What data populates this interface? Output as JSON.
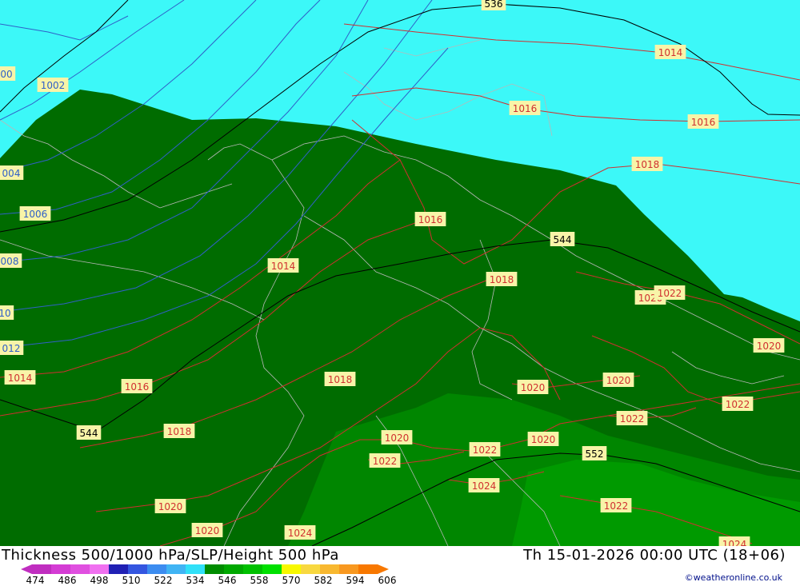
{
  "title": "Thickness 500/1000 hPa/SLP/Height 500 hPa",
  "datetime": "Th 15-01-2026 00:00 UTC (18+06)",
  "credit": "©weatheronline.co.uk",
  "legend": {
    "ticks": [
      "474",
      "486",
      "498",
      "510",
      "522",
      "534",
      "546",
      "558",
      "570",
      "582",
      "594",
      "606"
    ],
    "colors": [
      "#c02ec0",
      "#d43cd4",
      "#e050e0",
      "#f070f0",
      "#2020b4",
      "#3456e0",
      "#3c8cf0",
      "#40b4f4",
      "#30e0f8",
      "#008c00",
      "#00a800",
      "#00c000",
      "#00e000",
      "#f8f800",
      "#f8d840",
      "#f8b830",
      "#f89820",
      "#f87800"
    ]
  },
  "map": {
    "colors": {
      "cyan": "#3cf8f8",
      "dark_green": "#006c00",
      "mid_green": "#008600",
      "light_green": "#009a00",
      "slp_red": "#d03030",
      "slp_blue": "#3060c8",
      "height": "#000000",
      "border": "#b8b8b8",
      "label_bg": "#f8f4a8"
    },
    "labels": [
      {
        "text": "536",
        "kind": "height"
      },
      {
        "text": "544",
        "kind": "height"
      },
      {
        "text": "544",
        "kind": "height"
      },
      {
        "text": "552",
        "kind": "height"
      },
      {
        "text": "1014",
        "kind": "red"
      },
      {
        "text": "1016",
        "kind": "red"
      },
      {
        "text": "1016",
        "kind": "red"
      },
      {
        "text": "1018",
        "kind": "red"
      },
      {
        "text": "1016",
        "kind": "red"
      },
      {
        "text": "1014",
        "kind": "red"
      },
      {
        "text": "1018",
        "kind": "red"
      },
      {
        "text": "1020",
        "kind": "red"
      },
      {
        "text": "1022",
        "kind": "red"
      },
      {
        "text": "1020",
        "kind": "red"
      },
      {
        "text": "1014",
        "kind": "red"
      },
      {
        "text": "1016",
        "kind": "red"
      },
      {
        "text": "1018",
        "kind": "red"
      },
      {
        "text": "1020",
        "kind": "red"
      },
      {
        "text": "1020",
        "kind": "red"
      },
      {
        "text": "1022",
        "kind": "red"
      },
      {
        "text": "1022",
        "kind": "red"
      },
      {
        "text": "1018",
        "kind": "red"
      },
      {
        "text": "1020",
        "kind": "red"
      },
      {
        "text": "1022",
        "kind": "red"
      },
      {
        "text": "1022",
        "kind": "red"
      },
      {
        "text": "1020",
        "kind": "red"
      },
      {
        "text": "1020",
        "kind": "red"
      },
      {
        "text": "1024",
        "kind": "red"
      },
      {
        "text": "1020",
        "kind": "red"
      },
      {
        "text": "1024",
        "kind": "red"
      },
      {
        "text": "1022",
        "kind": "red"
      },
      {
        "text": "1024",
        "kind": "red"
      },
      {
        "text": "00",
        "kind": "blue"
      },
      {
        "text": "1002",
        "kind": "blue"
      },
      {
        "text": "004",
        "kind": "blue"
      },
      {
        "text": "1006",
        "kind": "blue"
      },
      {
        "text": "008",
        "kind": "blue"
      },
      {
        "text": "10",
        "kind": "blue"
      },
      {
        "text": "012",
        "kind": "blue"
      }
    ]
  }
}
